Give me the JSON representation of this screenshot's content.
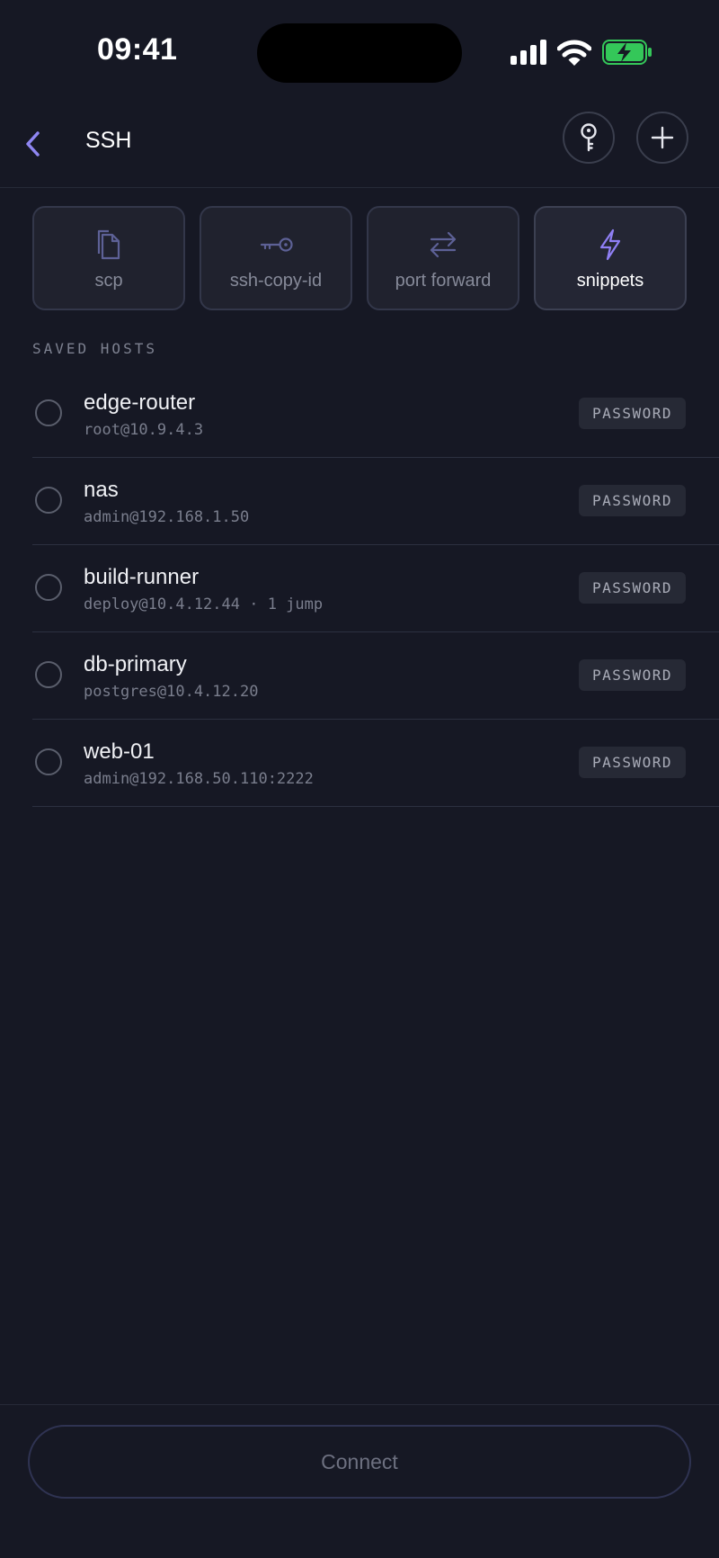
{
  "status_bar": {
    "time": "09:41",
    "icons": [
      "cellular-signal-icon",
      "wifi-icon",
      "battery-charging-icon"
    ],
    "battery_color": "#34c759"
  },
  "nav": {
    "title": "SSH",
    "back_icon": "chevron-left-icon",
    "actions": [
      "key-icon",
      "plus-icon"
    ]
  },
  "tools": [
    {
      "label": "scp",
      "icon": "copy-files-icon",
      "active": false
    },
    {
      "label": "ssh-copy-id",
      "icon": "key-icon",
      "active": false
    },
    {
      "label": "port forward",
      "icon": "arrows-swap-icon",
      "active": false
    },
    {
      "label": "snippets",
      "icon": "lightning-icon",
      "active": true
    }
  ],
  "saved_hosts": {
    "title": "SAVED HOSTS",
    "items": [
      {
        "name": "edge-router",
        "address": "root@10.9.4.3",
        "auth": "PASSWORD"
      },
      {
        "name": "nas",
        "address": "admin@192.168.1.50",
        "auth": "PASSWORD"
      },
      {
        "name": "build-runner",
        "address": "deploy@10.4.12.44 · 1 jump",
        "auth": "PASSWORD"
      },
      {
        "name": "db-primary",
        "address": "postgres@10.4.12.20",
        "auth": "PASSWORD"
      },
      {
        "name": "web-01",
        "address": "admin@192.168.50.110:2222",
        "auth": "PASSWORD"
      }
    ]
  },
  "footer": {
    "connect_label": "Connect"
  },
  "colors": {
    "background": "#161824",
    "accent": "#8f7ff5",
    "icon_muted": "#5d6196"
  }
}
